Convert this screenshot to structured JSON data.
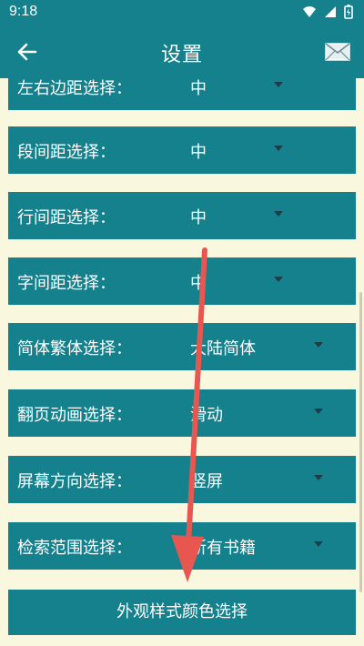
{
  "status_bar": {
    "time": "9:18",
    "icons": [
      "wifi-icon",
      "signal-icon",
      "battery-icon"
    ]
  },
  "app_bar": {
    "title": "设置",
    "back_icon": "back-arrow-icon",
    "mail_icon": "mail-icon"
  },
  "settings": [
    {
      "label": "左右边距选择：",
      "value": "中"
    },
    {
      "label": "段间距选择：",
      "value": "中"
    },
    {
      "label": "行间距选择：",
      "value": "中"
    },
    {
      "label": "字间距选择：",
      "value": "中"
    },
    {
      "label": "简体繁体选择：",
      "value": "大陆简体"
    },
    {
      "label": "翻页动画选择：",
      "value": "滑动"
    },
    {
      "label": "屏幕方向选择：",
      "value": "竖屏"
    },
    {
      "label": "检索范围选择：",
      "value": "所有书籍"
    }
  ],
  "bottom_button": {
    "label": "外观样式颜色选择"
  },
  "colors": {
    "primary": "#14818D",
    "background": "#FAF7DF",
    "arrow": "#E8574F",
    "dropdown_caret": "#1f3d44"
  }
}
